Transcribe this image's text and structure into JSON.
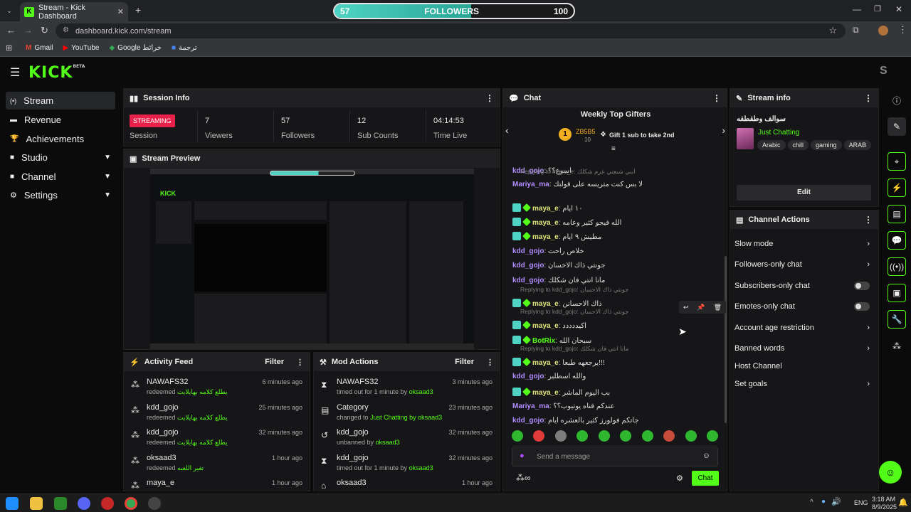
{
  "browser": {
    "tab_title": "Stream - Kick Dashboard",
    "url": "dashboard.kick.com/stream",
    "bookmarks": [
      "Gmail",
      "YouTube",
      "Google خرائط",
      "ترجمة"
    ]
  },
  "followers_overlay": {
    "label": "FOLLOWERS",
    "current": "57",
    "goal": "100",
    "progress": 0.57
  },
  "app": {
    "logo": "KICK",
    "logo_sup": "BETA",
    "avatar_letter": "S"
  },
  "sidebar": {
    "items": [
      {
        "label": "Stream",
        "icon": "stream-icon"
      },
      {
        "label": "Revenue",
        "icon": "revenue-icon"
      },
      {
        "label": "Achievements",
        "icon": "trophy-icon"
      },
      {
        "label": "Studio",
        "icon": "studio-icon"
      },
      {
        "label": "Channel",
        "icon": "channel-icon"
      },
      {
        "label": "Settings",
        "icon": "gear-icon"
      }
    ]
  },
  "session": {
    "title": "Session Info",
    "status": "STREAMING",
    "status_label": "Session",
    "stats": [
      {
        "value": "7",
        "label": "Viewers"
      },
      {
        "value": "57",
        "label": "Followers"
      },
      {
        "value": "12",
        "label": "Sub Counts"
      },
      {
        "value": "04:14:53",
        "label": "Time Live"
      }
    ]
  },
  "preview": {
    "title": "Stream Preview"
  },
  "activity": {
    "title": "Activity Feed",
    "filter": "Filter",
    "rows": [
      {
        "name": "NAWAFS32",
        "action": "redeemed",
        "detail": "يطلع كلامه بهايلايت",
        "time": "6 minutes ago"
      },
      {
        "name": "kdd_gojo",
        "action": "redeemed",
        "detail": "يطلع كلامه بهايلايت",
        "time": "25 minutes ago"
      },
      {
        "name": "kdd_gojo",
        "action": "redeemed",
        "detail": "يطلع كلامه بهايلايت",
        "time": "32 minutes ago"
      },
      {
        "name": "oksaad3",
        "action": "redeemed",
        "detail": "تغير اللعبه",
        "time": "1 hour ago"
      },
      {
        "name": "maya_e",
        "action": "",
        "detail": "",
        "time": "1 hour ago"
      }
    ]
  },
  "mod": {
    "title": "Mod Actions",
    "filter": "Filter",
    "rows": [
      {
        "name": "NAWAFS32",
        "pre": "timed out for 1 minute by",
        "detail": "",
        "by": "oksaad3",
        "time": "3 minutes ago",
        "icon": "hourglass-icon"
      },
      {
        "name": "Category",
        "pre": "changed to",
        "detail": "Just Chatting",
        "by": " by oksaad3",
        "time": "23 minutes ago",
        "icon": "category-icon"
      },
      {
        "name": "kdd_gojo",
        "pre": "unbanned by",
        "detail": "",
        "by": "oksaad3",
        "time": "32 minutes ago",
        "icon": "undo-icon"
      },
      {
        "name": "kdd_gojo",
        "pre": "timed out for 1 minute by",
        "detail": "",
        "by": "oksaad3",
        "time": "32 minutes ago",
        "icon": "hourglass-icon"
      },
      {
        "name": "oksaad3",
        "pre": "",
        "detail": "",
        "by": "",
        "time": "1 hour ago",
        "icon": "ban-icon"
      }
    ]
  },
  "chat": {
    "title": "Chat",
    "gifters_title": "Weekly Top Gifters",
    "top_gifter": {
      "rank": "1",
      "name": "ZB5B5",
      "count": "10"
    },
    "gift_cta": "Gift 1 sub to take 2nd",
    "messages": [
      {
        "reply": "",
        "user": "kdd_gojo",
        "color": "#b18cff",
        "text": "اسوع؟؟",
        "badges": 0
      },
      {
        "reply": "Replying to maya_e: ابني شبعتي عرم شكلك",
        "user": "Mariya_ma",
        "color": "#b18cff",
        "text": "لا بس كنت متريسه على قولتك",
        "badges": 0
      },
      {
        "reply": "",
        "user": "maya_e",
        "color": "#dfe37a",
        "text": "١٠ ايام",
        "badges": 2
      },
      {
        "reply": "",
        "user": "maya_e",
        "color": "#dfe37a",
        "text": "الله فيجو كثير وعامه",
        "badges": 2
      },
      {
        "reply": "",
        "user": "maya_e",
        "color": "#dfe37a",
        "text": "مطيش ٩ ايام",
        "badges": 2
      },
      {
        "reply": "",
        "user": "kdd_gojo",
        "color": "#b18cff",
        "text": "خلاص راحت",
        "badges": 0
      },
      {
        "reply": "",
        "user": "kdd_gojo",
        "color": "#b18cff",
        "text": "جونتي ذاك الاحسان",
        "badges": 0
      },
      {
        "reply": "",
        "user": "kdd_gojo",
        "color": "#b18cff",
        "text": "مانا انتي فان شكلك",
        "badges": 0
      },
      {
        "reply": "Replying to kdd_gojo: جونتي ذاك الاحسان",
        "user": "maya_e",
        "color": "#dfe37a",
        "text": "ذاك الاحسانن",
        "badges": 2
      },
      {
        "reply": "Replying to kdd_gojo: جونتي ذاك الاحسان",
        "user": "maya_e",
        "color": "#dfe37a",
        "text": "اكيددددد",
        "badges": 2
      },
      {
        "reply": "",
        "user": "BotRix",
        "color": "#53fc18",
        "text": "سبحان الله",
        "badges": 2
      },
      {
        "reply": "Replying to kdd_gojo: مانا انتي فان شكلك",
        "user": "maya_e",
        "color": "#dfe37a",
        "text": "يرجعهه طبعا!!!",
        "badges": 2
      },
      {
        "reply": "",
        "user": "kdd_gojo",
        "color": "#b18cff",
        "text": "والله اسطلبر",
        "badges": 0
      },
      {
        "reply": "",
        "user": "maya_e",
        "color": "#dfe37a",
        "text": "بب اليوم الماشر",
        "badges": 2
      },
      {
        "reply": "",
        "user": "Mariya_ma",
        "color": "#b18cff",
        "text": "عندكم قناه يوتيوب؟؟",
        "badges": 0
      },
      {
        "reply": "",
        "user": "kdd_gojo",
        "color": "#b18cff",
        "text": "جاتكم فولورز كثير بالعشره ايام",
        "badges": 0
      }
    ],
    "input_placeholder": "Send a message",
    "send": "Chat"
  },
  "stream_info": {
    "title": "Stream info",
    "stream_title": "سوالف وطقطقه",
    "category": "Just Chatting",
    "tags": [
      "Arabic",
      "chill",
      "gaming",
      "ARAB"
    ],
    "edit": "Edit"
  },
  "channel_actions": {
    "title": "Channel Actions",
    "items": [
      {
        "label": "Slow mode",
        "control": "chevron"
      },
      {
        "label": "Followers-only chat",
        "control": "chevron"
      },
      {
        "label": "Subscribers-only chat",
        "control": "toggle"
      },
      {
        "label": "Emotes-only chat",
        "control": "toggle"
      },
      {
        "label": "Account age restriction",
        "control": "chevron"
      },
      {
        "label": "Banned words",
        "control": "chevron"
      },
      {
        "label": "Host Channel",
        "control": "none"
      },
      {
        "label": "Set goals",
        "control": "chevron"
      }
    ]
  },
  "taskbar": {
    "lang": "ENG",
    "time": "3:18 AM",
    "date": "8/9/2025"
  },
  "colors": {
    "accent": "#53fc18",
    "panel": "#161618",
    "streaming": "#e8214b"
  }
}
